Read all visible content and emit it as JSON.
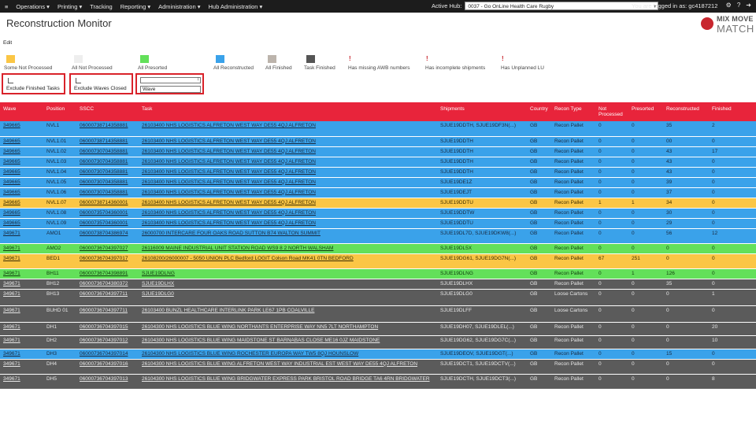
{
  "topbar": {
    "menu": [
      "Operations",
      "Printing",
      "Tracking",
      "Reporting",
      "Administration",
      "Hub Administration"
    ],
    "active_hub_label": "Active Hub:",
    "active_hub_value": "0037 - Go OnLine Health Care Rugby",
    "user_text": "You are logged in as: gc4187212",
    "icons": [
      "settings-icon",
      "help-icon",
      "logout-icon"
    ]
  },
  "page": {
    "title": "Reconstruction Monitor",
    "edit": "Edit"
  },
  "logo": {
    "line1": "MIX MOVE",
    "line2": "MATCH"
  },
  "legend": [
    {
      "type": "swatch",
      "color": "#fbc645",
      "label": "Some Not Processed"
    },
    {
      "type": "swatch",
      "color": "#eeeeee",
      "label": "All Not Processed"
    },
    {
      "type": "swatch",
      "color": "#63e05a",
      "label": "All Presorted"
    },
    {
      "type": "swatch",
      "color": "#3aa2ea",
      "label": "All Reconstructed"
    },
    {
      "type": "swatch",
      "color": "#bcb4ac",
      "label": "All Finished"
    },
    {
      "type": "swatch",
      "color": "#555555",
      "label": "Task Finished"
    },
    {
      "type": "mark",
      "mark": "!",
      "label": "Has missing AWB numbers"
    },
    {
      "type": "mark",
      "mark": "!",
      "label": "Has incomplete shipments"
    },
    {
      "type": "mark",
      "mark": "!",
      "label": "Has Unplanned LU"
    }
  ],
  "filters": {
    "exclude_finished_tasks": "Exclude Finished Tasks",
    "exclude_waves_closed": "Exclude Waves Closed",
    "wave_placeholder": "Wave"
  },
  "table": {
    "headers": [
      "Wave",
      "Position",
      "SSCC",
      "Task",
      "Shipments",
      "Country",
      "Recon Type",
      "Not Processed",
      "Presorted",
      "Reconstructed",
      "Finished"
    ],
    "rows": [
      {
        "class": "blue r2",
        "cells": [
          "349665",
          "NVL1",
          "06000738714358881",
          "26103400 NHS LOGISTICS ALFRETON WEST WAY DE55 4QJ ALFRETON",
          "SJUE19DDTH, SJUE19DF3N(...)",
          "GB",
          "Recon Pallet",
          "0",
          "0",
          "35",
          "2"
        ]
      },
      {
        "class": "blue r1",
        "cells": [
          "349665",
          "NVL1.01",
          "06000738714358881",
          "26103400 NHS LOGISTICS ALFRETON WEST WAY DE55 4QJ ALFRETON",
          "SJUE19DDTH",
          "GB",
          "Recon Pallet",
          "0",
          "0",
          "00",
          "0"
        ]
      },
      {
        "class": "blue r1",
        "cells": [
          "349665",
          "NVL1.02",
          "06000730704358881",
          "26103400 NHS LOGISTICS ALFRETON WEST WAY DE55 4QJ ALFRETON",
          "SJUE19DDTH",
          "GB",
          "Recon Pallet",
          "0",
          "0",
          "43",
          "17"
        ]
      },
      {
        "class": "blue r1",
        "cells": [
          "349665",
          "NVL1.03",
          "06000730704358881",
          "26103400 NHS LOGISTICS ALFRETON WEST WAY DE55 4QJ ALFRETON",
          "SJUE19DDTH",
          "GB",
          "Recon Pallet",
          "0",
          "0",
          "43",
          "0"
        ]
      },
      {
        "class": "blue r1",
        "cells": [
          "349665",
          "NVL1.04",
          "06000730704358881",
          "26103400 NHS LOGISTICS ALFRETON WEST WAY DE55 4QJ ALFRETON",
          "SJUE19DDTH",
          "GB",
          "Recon Pallet",
          "0",
          "0",
          "43",
          "0"
        ]
      },
      {
        "class": "blue r1",
        "cells": [
          "349665",
          "NVL1.05",
          "06000730704358881",
          "26103400 NHS LOGISTICS ALFRETON WEST WAY DE55 4QJ ALFRETON",
          "SJUE19DE1Z",
          "GB",
          "Recon Pallet",
          "0",
          "0",
          "39",
          "0"
        ]
      },
      {
        "class": "blue r1",
        "cells": [
          "349665",
          "NVL1.06",
          "06000730704358881",
          "26103400 NHS LOGISTICS ALFRETON WEST WAY DE55 4QJ ALFRETON",
          "SJUE19DEJT",
          "GB",
          "Recon Pallet",
          "0",
          "0",
          "37",
          "0"
        ]
      },
      {
        "class": "orange r1",
        "cells": [
          "349665",
          "NVL1.07",
          "06000738714360001",
          "26103400 NHS LOGISTICS ALFRETON WEST WAY DE55 4QJ ALFRETON",
          "SJUE19DDTU",
          "GB",
          "Recon Pallet",
          "1",
          "1",
          "34",
          "0"
        ]
      },
      {
        "class": "blue r1",
        "cells": [
          "349665",
          "NVL1.08",
          "06000735704360001",
          "26103400 NHS LOGISTICS ALFRETON WEST WAY DE55 4QJ ALFRETON",
          "SJUE19DDTW",
          "GB",
          "Recon Pallet",
          "0",
          "0",
          "30",
          "0"
        ]
      },
      {
        "class": "blue r1",
        "cells": [
          "349665",
          "NVL1.09",
          "06000735704360001",
          "26103400 NHS LOGISTICS ALFRETON WEST WAY DE55 4QJ ALFRETON",
          "SJUE19DDTU",
          "GB",
          "Recon Pallet",
          "0",
          "0",
          "29",
          "0"
        ]
      },
      {
        "class": "blue r2",
        "cells": [
          "349671",
          "AMO1",
          "06000738704386974",
          "26000700 INTERCARE FOUR OAKS ROAD SUTTON B74 WALTON SUMMIT",
          "SJUE19DL7D, SJUE19DKW8(...)",
          "GB",
          "Recon Pallet",
          "0",
          "0",
          "56",
          "12"
        ]
      },
      {
        "class": "green r1",
        "cells": [
          "349671",
          "AMO2",
          "06000736704397027",
          "26116009 MAINE INDUSTRIAL UNIT STATION ROAD WS9 8 2 NORTH WALSHAM",
          "SJUE19DL5X",
          "GB",
          "Recon Pallet",
          "0",
          "0",
          "0",
          "0"
        ]
      },
      {
        "class": "orange r2",
        "cells": [
          "349671",
          "BED1",
          "06000736704397017",
          "26108200/26000007 - 5050 UNION PLC Bedford LOGIT Colson Road MK41 0TN BEDFORD",
          "SJUE19DG61, SJUE19DG7N(...)",
          "GB",
          "Recon Pallet",
          "67",
          "251",
          "0",
          "0"
        ]
      },
      {
        "class": "green r1",
        "cells": [
          "349671",
          "BH11",
          "06000736704398891",
          "SJUE19DLNG",
          "SJUE19DLNG",
          "GB",
          "Recon Pallet",
          "0",
          "1",
          "126",
          "0"
        ]
      },
      {
        "class": "dark r1",
        "cells": [
          "349671",
          "BH12",
          "06000736704380372",
          "SJUE19DLHX",
          "SJUE19DLHX",
          "GB",
          "Recon Pallet",
          "0",
          "0",
          "35",
          "0"
        ]
      },
      {
        "class": "dark r3",
        "cells": [
          "349671",
          "BH13",
          "06000736704397711",
          "SJUE19DLG0",
          "SJUE19DLG0",
          "GB",
          "Loose Cartons",
          "0",
          "0",
          "0",
          "1"
        ]
      },
      {
        "class": "dark r3",
        "cells": [
          "349671",
          "BUHD 01",
          "06000736704397711",
          "26103400 BUNZL HEALTHCARE INTERLINK PARK LE67 1PB COALVILLE",
          "SJUE19DLFF",
          "GB",
          "Loose Cartons",
          "0",
          "0",
          "0",
          "0"
        ]
      },
      {
        "class": "dark r4",
        "cells": [
          "349671",
          "DH1",
          "06000736704397015",
          "26104300 NHS LOGISTICS BLUE WING NORTHANTS ENTERPRISE WAY NN5 7LT NORTHAMPTON",
          "SJUE19DH07, SJUE19DLEL(...)",
          "GB",
          "Recon Pallet",
          "0",
          "0",
          "0",
          "20"
        ]
      },
      {
        "class": "dark r4",
        "cells": [
          "349671",
          "DH2",
          "06000736704397012",
          "26104300 NHS LOGISTICS BLUE WING MAIDSTONE ST BARNABAS CLOSE ME16 0JZ MAIDSTONE",
          "SJUE19DG62, SJUE19DG7C(...)",
          "GB",
          "Recon Pallet",
          "0",
          "0",
          "0",
          "10"
        ]
      },
      {
        "class": "blue r1",
        "cells": [
          "349671",
          "DH3",
          "06000736704397014",
          "26104300 NHS LOGISTICS BLUE WING ROCHESTER EUROPA WAY TW5 8QJ HOUNSLOW",
          "SJUE19DEOV, SJUE19DGT(...)",
          "GB",
          "Recon Pallet",
          "0",
          "0",
          "15",
          "0"
        ]
      },
      {
        "class": "dark r2",
        "cells": [
          "349671",
          "DH4",
          "06000736704397016",
          "26104300 NHS LOGISTICS BLUE WING ALFRETON WEST WAY INDUSTRIAL EST WEST WAY DE55 4QJ ALFRETON",
          "SJUE19DCT1, SJUE19DCTV(...)",
          "GB",
          "Recon Pallet",
          "0",
          "0",
          "0",
          "0"
        ]
      },
      {
        "class": "dark r2",
        "cells": [
          "349671",
          "DH5",
          "06000736704397013",
          "26104300 NHS LOGISTICS BLUE WING BRIDGWATER EXPRESS PARK BRISTOL ROAD BRIDGE TA6 4RN BRIDGWATER",
          "SJUE19DCTH, SJUE19DCT3(...)",
          "GB",
          "Recon Pallet",
          "0",
          "0",
          "0",
          "8"
        ]
      }
    ]
  }
}
